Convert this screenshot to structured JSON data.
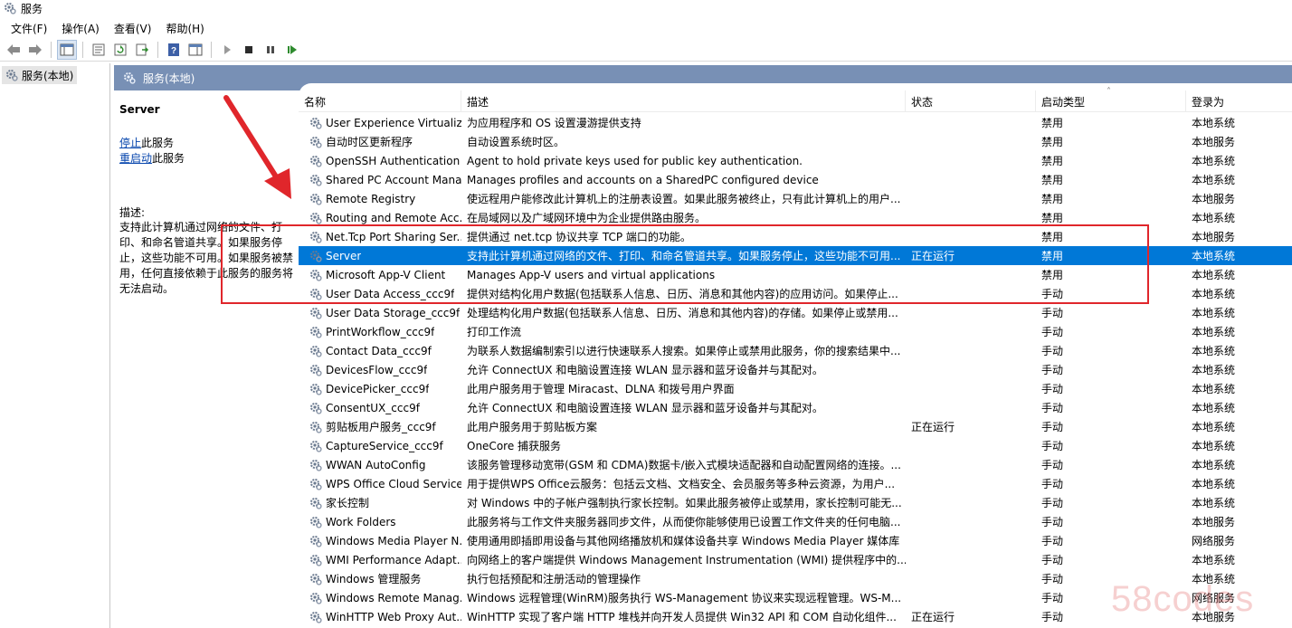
{
  "window": {
    "title": "服务"
  },
  "menu": [
    "文件(F)",
    "操作(A)",
    "查看(V)",
    "帮助(H)"
  ],
  "tree": {
    "item": "服务(本地)"
  },
  "panel": {
    "header": "服务(本地)"
  },
  "desc_pane": {
    "service_name": "Server",
    "stop_link": "停止",
    "stop_suffix": "此服务",
    "restart_link": "重启动",
    "restart_suffix": "此服务",
    "desc_label": "描述:",
    "desc_text": "支持此计算机通过网络的文件、打印、和命名管道共享。如果服务停止，这些功能不可用。如果服务被禁用，任何直接依赖于此服务的服务将无法启动。"
  },
  "columns": [
    "名称",
    "描述",
    "状态",
    "启动类型",
    "登录为"
  ],
  "services": [
    {
      "name": "User Experience Virtualiz...",
      "desc": "为应用程序和 OS 设置漫游提供支持",
      "status": "",
      "startup": "禁用",
      "logon": "本地系统"
    },
    {
      "name": "自动时区更新程序",
      "desc": "自动设置系统时区。",
      "status": "",
      "startup": "禁用",
      "logon": "本地服务"
    },
    {
      "name": "OpenSSH Authentication ...",
      "desc": "Agent to hold private keys used for public key authentication.",
      "status": "",
      "startup": "禁用",
      "logon": "本地系统"
    },
    {
      "name": "Shared PC Account Mana...",
      "desc": "Manages profiles and accounts on a SharedPC configured device",
      "status": "",
      "startup": "禁用",
      "logon": "本地系统"
    },
    {
      "name": "Remote Registry",
      "desc": "使远程用户能修改此计算机上的注册表设置。如果此服务被终止，只有此计算机上的用户...",
      "status": "",
      "startup": "禁用",
      "logon": "本地服务"
    },
    {
      "name": "Routing and Remote Acc...",
      "desc": "在局域网以及广域网环境中为企业提供路由服务。",
      "status": "",
      "startup": "禁用",
      "logon": "本地系统"
    },
    {
      "name": "Net.Tcp Port Sharing Ser...",
      "desc": "提供通过 net.tcp 协议共享 TCP 端口的功能。",
      "status": "",
      "startup": "禁用",
      "logon": "本地服务"
    },
    {
      "name": "Server",
      "desc": "支持此计算机通过网络的文件、打印、和命名管道共享。如果服务停止，这些功能不可用...",
      "status": "正在运行",
      "startup": "禁用",
      "logon": "本地系统"
    },
    {
      "name": "Microsoft App-V Client",
      "desc": "Manages App-V users and virtual applications",
      "status": "",
      "startup": "禁用",
      "logon": "本地系统"
    },
    {
      "name": "User Data Access_ccc9f",
      "desc": "提供对结构化用户数据(包括联系人信息、日历、消息和其他内容)的应用访问。如果停止...",
      "status": "",
      "startup": "手动",
      "logon": "本地系统"
    },
    {
      "name": "User Data Storage_ccc9f",
      "desc": "处理结构化用户数据(包括联系人信息、日历、消息和其他内容)的存储。如果停止或禁用...",
      "status": "",
      "startup": "手动",
      "logon": "本地系统"
    },
    {
      "name": "PrintWorkflow_ccc9f",
      "desc": "打印工作流",
      "status": "",
      "startup": "手动",
      "logon": "本地系统"
    },
    {
      "name": "Contact Data_ccc9f",
      "desc": "为联系人数据编制索引以进行快速联系人搜索。如果停止或禁用此服务，你的搜索结果中...",
      "status": "",
      "startup": "手动",
      "logon": "本地系统"
    },
    {
      "name": "DevicesFlow_ccc9f",
      "desc": "允许 ConnectUX 和电脑设置连接 WLAN 显示器和蓝牙设备并与其配对。",
      "status": "",
      "startup": "手动",
      "logon": "本地系统"
    },
    {
      "name": "DevicePicker_ccc9f",
      "desc": "此用户服务用于管理 Miracast、DLNA 和拨号用户界面",
      "status": "",
      "startup": "手动",
      "logon": "本地系统"
    },
    {
      "name": "ConsentUX_ccc9f",
      "desc": "允许 ConnectUX 和电脑设置连接 WLAN 显示器和蓝牙设备并与其配对。",
      "status": "",
      "startup": "手动",
      "logon": "本地系统"
    },
    {
      "name": "剪贴板用户服务_ccc9f",
      "desc": "此用户服务用于剪贴板方案",
      "status": "正在运行",
      "startup": "手动",
      "logon": "本地系统"
    },
    {
      "name": "CaptureService_ccc9f",
      "desc": "OneCore 捕获服务",
      "status": "",
      "startup": "手动",
      "logon": "本地系统"
    },
    {
      "name": "WWAN AutoConfig",
      "desc": "该服务管理移动宽带(GSM 和 CDMA)数据卡/嵌入式模块适配器和自动配置网络的连接。...",
      "status": "",
      "startup": "手动",
      "logon": "本地系统"
    },
    {
      "name": "WPS Office Cloud Service",
      "desc": "用于提供WPS Office云服务：包括云文档、文档安全、会员服务等多种云资源，为用户...",
      "status": "",
      "startup": "手动",
      "logon": "本地系统"
    },
    {
      "name": "家长控制",
      "desc": "对 Windows 中的子帐户强制执行家长控制。如果此服务被停止或禁用，家长控制可能无...",
      "status": "",
      "startup": "手动",
      "logon": "本地系统"
    },
    {
      "name": "Work Folders",
      "desc": "此服务将与工作文件夹服务器同步文件，从而使你能够使用已设置工作文件夹的任何电脑...",
      "status": "",
      "startup": "手动",
      "logon": "本地服务"
    },
    {
      "name": "Windows Media Player N...",
      "desc": "使用通用即插即用设备与其他网络播放机和媒体设备共享 Windows Media Player 媒体库",
      "status": "",
      "startup": "手动",
      "logon": "网络服务"
    },
    {
      "name": "WMI Performance Adapt...",
      "desc": "向网络上的客户端提供 Windows Management Instrumentation (WMI) 提供程序中的...",
      "status": "",
      "startup": "手动",
      "logon": "本地系统"
    },
    {
      "name": "Windows 管理服务",
      "desc": "执行包括预配和注册活动的管理操作",
      "status": "",
      "startup": "手动",
      "logon": "本地系统"
    },
    {
      "name": "Windows Remote Manag...",
      "desc": "Windows 远程管理(WinRM)服务执行 WS-Management 协议来实现远程管理。WS-M...",
      "status": "",
      "startup": "手动",
      "logon": "网络服务"
    },
    {
      "name": "WinHTTP Web Proxy Aut...",
      "desc": "WinHTTP 实现了客户端 HTTP 堆栈并向开发人员提供 Win32 API 和 COM 自动化组件...",
      "status": "正在运行",
      "startup": "手动",
      "logon": "本地服务"
    }
  ],
  "selected_index": 7,
  "watermark": "58codes",
  "colors": {
    "header_blue": "#7890b5",
    "selected_row": "#0078d7",
    "annotation_red": "#e0262b",
    "link": "#0645ad"
  }
}
